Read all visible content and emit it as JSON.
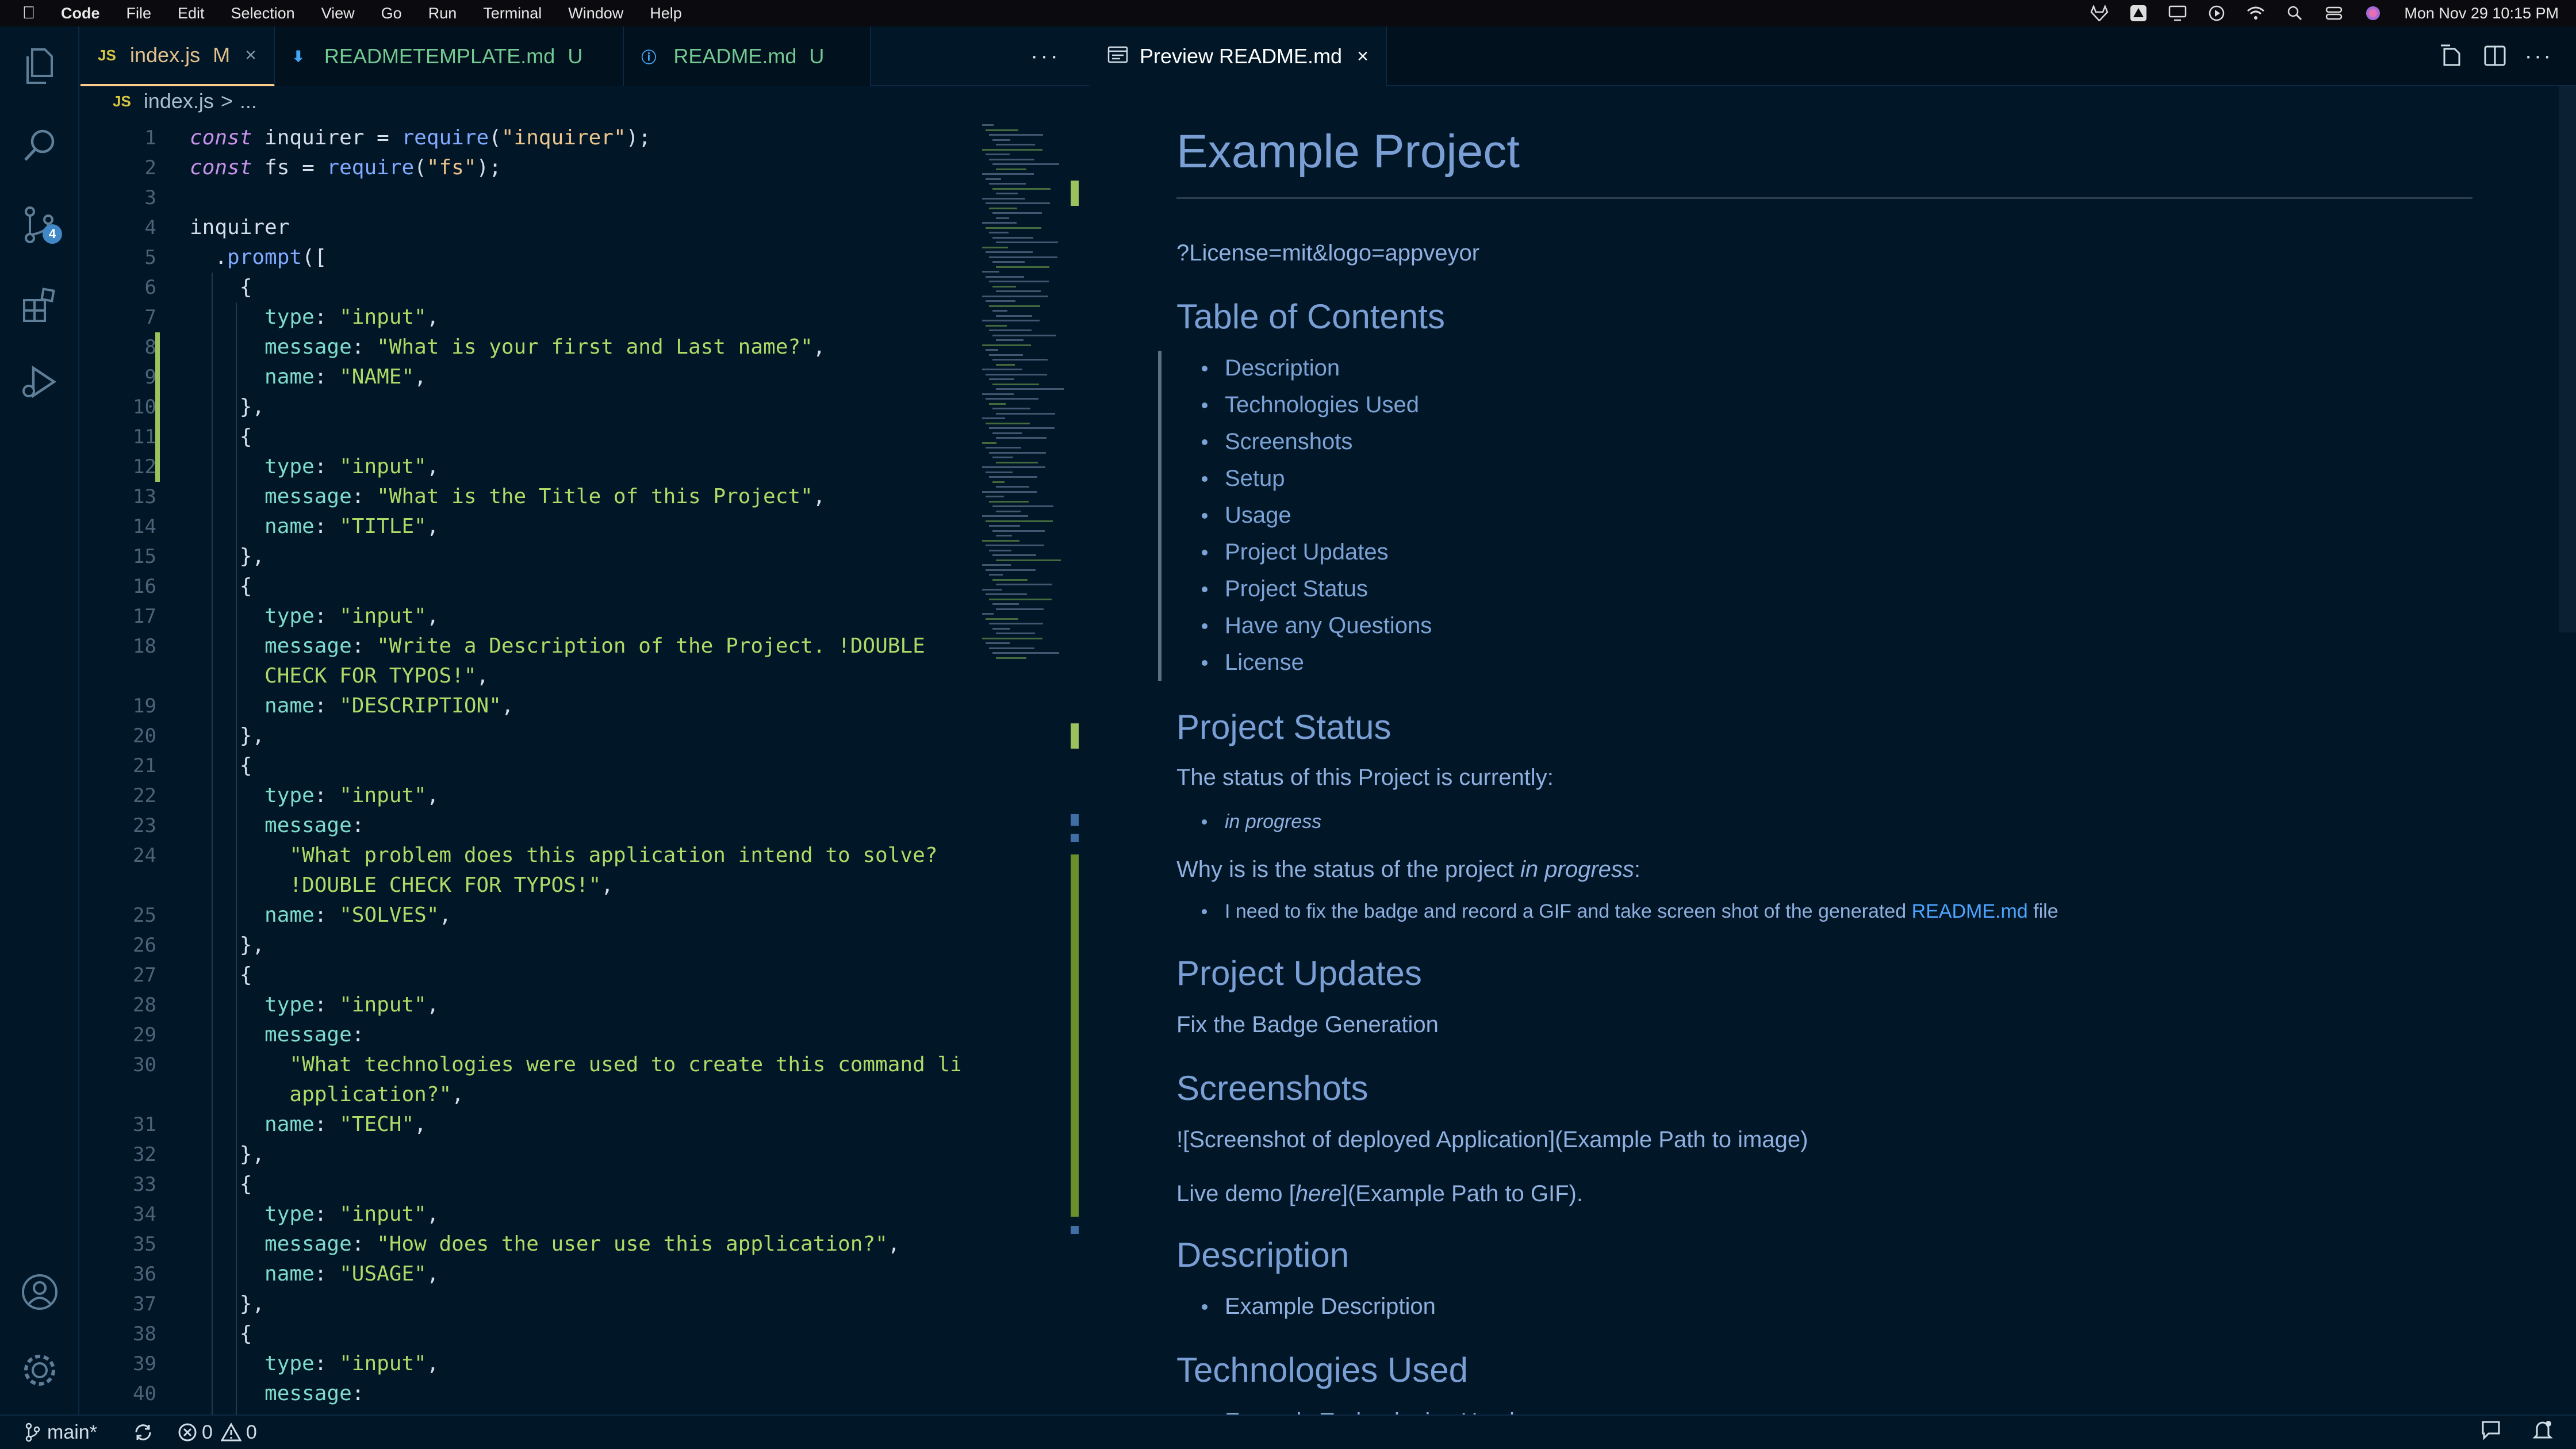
{
  "menubar": {
    "app": "Code",
    "items": [
      "File",
      "Edit",
      "Selection",
      "View",
      "Go",
      "Run",
      "Terminal",
      "Window",
      "Help"
    ],
    "clock": "Mon Nov 29  10:15 PM"
  },
  "activitybar": {
    "source_control_badge": "4"
  },
  "left_tabs": [
    {
      "icon": "JS",
      "label": "index.js",
      "state": "M",
      "close": "×"
    },
    {
      "icon": "⬇",
      "label": "READMETEMPLATE.md",
      "state": "U"
    },
    {
      "icon": "ⓘ",
      "label": "README.md",
      "state": "U"
    }
  ],
  "left_tabs_more": "···",
  "breadcrumb": {
    "icon": "JS",
    "file": "index.js",
    "sep": ">",
    "rest": "..."
  },
  "code_lines": [
    {
      "n": "1",
      "tokens": [
        [
          "kw",
          "const "
        ],
        [
          "var",
          "inquirer = "
        ],
        [
          "fn",
          "require"
        ],
        [
          "var",
          "("
        ],
        [
          "str",
          "\"inquirer\""
        ],
        [
          "var",
          ");"
        ]
      ]
    },
    {
      "n": "2",
      "tokens": [
        [
          "kw",
          "const "
        ],
        [
          "var",
          "fs = "
        ],
        [
          "fn",
          "require"
        ],
        [
          "var",
          "("
        ],
        [
          "str",
          "\"fs\""
        ],
        [
          "var",
          ");"
        ]
      ]
    },
    {
      "n": "3",
      "tokens": []
    },
    {
      "n": "4",
      "tokens": [
        [
          "var",
          "inquirer"
        ]
      ]
    },
    {
      "n": "5",
      "tokens": [
        [
          "var",
          "  ."
        ],
        [
          "fn",
          "prompt"
        ],
        [
          "var",
          "(["
        ]
      ]
    },
    {
      "n": "6",
      "tokens": [
        [
          "var",
          "    {"
        ]
      ]
    },
    {
      "n": "7",
      "tokens": [
        [
          "prop",
          "      type"
        ],
        [
          "var",
          ": "
        ],
        [
          "str2",
          "\"input\""
        ],
        [
          "var",
          ","
        ]
      ]
    },
    {
      "n": "8",
      "tokens": [
        [
          "prop",
          "      message"
        ],
        [
          "var",
          ": "
        ],
        [
          "str2",
          "\"What is your first and Last name?\""
        ],
        [
          "var",
          ","
        ]
      ]
    },
    {
      "n": "9",
      "tokens": [
        [
          "prop",
          "      name"
        ],
        [
          "var",
          ": "
        ],
        [
          "str2",
          "\"NAME\""
        ],
        [
          "var",
          ","
        ]
      ]
    },
    {
      "n": "10",
      "tokens": [
        [
          "var",
          "    },"
        ]
      ]
    },
    {
      "n": "11",
      "tokens": [
        [
          "var",
          "    {"
        ]
      ]
    },
    {
      "n": "12",
      "tokens": [
        [
          "prop",
          "      type"
        ],
        [
          "var",
          ": "
        ],
        [
          "str2",
          "\"input\""
        ],
        [
          "var",
          ","
        ]
      ]
    },
    {
      "n": "13",
      "tokens": [
        [
          "prop",
          "      message"
        ],
        [
          "var",
          ": "
        ],
        [
          "str2",
          "\"What is the Title of this Project\""
        ],
        [
          "var",
          ","
        ]
      ]
    },
    {
      "n": "14",
      "tokens": [
        [
          "prop",
          "      name"
        ],
        [
          "var",
          ": "
        ],
        [
          "str2",
          "\"TITLE\""
        ],
        [
          "var",
          ","
        ]
      ]
    },
    {
      "n": "15",
      "tokens": [
        [
          "var",
          "    },"
        ]
      ]
    },
    {
      "n": "16",
      "tokens": [
        [
          "var",
          "    {"
        ]
      ]
    },
    {
      "n": "17",
      "tokens": [
        [
          "prop",
          "      type"
        ],
        [
          "var",
          ": "
        ],
        [
          "str2",
          "\"input\""
        ],
        [
          "var",
          ","
        ]
      ]
    },
    {
      "n": "18",
      "tokens": [
        [
          "prop",
          "      message"
        ],
        [
          "var",
          ": "
        ],
        [
          "str2",
          "\"Write a Description of the Project. !DOUBLE"
        ]
      ]
    },
    {
      "n": "",
      "tokens": [
        [
          "str2",
          "      CHECK FOR TYPOS!\""
        ],
        [
          "var",
          ","
        ]
      ]
    },
    {
      "n": "19",
      "tokens": [
        [
          "prop",
          "      name"
        ],
        [
          "var",
          ": "
        ],
        [
          "str2",
          "\"DESCRIPTION\""
        ],
        [
          "var",
          ","
        ]
      ]
    },
    {
      "n": "20",
      "tokens": [
        [
          "var",
          "    },"
        ]
      ]
    },
    {
      "n": "21",
      "tokens": [
        [
          "var",
          "    {"
        ]
      ]
    },
    {
      "n": "22",
      "tokens": [
        [
          "prop",
          "      type"
        ],
        [
          "var",
          ": "
        ],
        [
          "str2",
          "\"input\""
        ],
        [
          "var",
          ","
        ]
      ]
    },
    {
      "n": "23",
      "tokens": [
        [
          "prop",
          "      message"
        ],
        [
          "var",
          ":"
        ]
      ]
    },
    {
      "n": "24",
      "tokens": [
        [
          "str2",
          "        \"What problem does this application intend to solve?"
        ]
      ]
    },
    {
      "n": "",
      "tokens": [
        [
          "str2",
          "        !DOUBLE CHECK FOR TYPOS!\""
        ],
        [
          "var",
          ","
        ]
      ]
    },
    {
      "n": "25",
      "tokens": [
        [
          "prop",
          "      name"
        ],
        [
          "var",
          ": "
        ],
        [
          "str2",
          "\"SOLVES\""
        ],
        [
          "var",
          ","
        ]
      ]
    },
    {
      "n": "26",
      "tokens": [
        [
          "var",
          "    },"
        ]
      ]
    },
    {
      "n": "27",
      "tokens": [
        [
          "var",
          "    {"
        ]
      ]
    },
    {
      "n": "28",
      "tokens": [
        [
          "prop",
          "      type"
        ],
        [
          "var",
          ": "
        ],
        [
          "str2",
          "\"input\""
        ],
        [
          "var",
          ","
        ]
      ]
    },
    {
      "n": "29",
      "tokens": [
        [
          "prop",
          "      message"
        ],
        [
          "var",
          ":"
        ]
      ]
    },
    {
      "n": "30",
      "tokens": [
        [
          "str2",
          "        \"What technologies were used to create this command line"
        ]
      ]
    },
    {
      "n": "",
      "tokens": [
        [
          "str2",
          "        application?\""
        ],
        [
          "var",
          ","
        ]
      ]
    },
    {
      "n": "31",
      "tokens": [
        [
          "prop",
          "      name"
        ],
        [
          "var",
          ": "
        ],
        [
          "str2",
          "\"TECH\""
        ],
        [
          "var",
          ","
        ]
      ]
    },
    {
      "n": "32",
      "tokens": [
        [
          "var",
          "    },"
        ]
      ]
    },
    {
      "n": "33",
      "tokens": [
        [
          "var",
          "    {"
        ]
      ]
    },
    {
      "n": "34",
      "tokens": [
        [
          "prop",
          "      type"
        ],
        [
          "var",
          ": "
        ],
        [
          "str2",
          "\"input\""
        ],
        [
          "var",
          ","
        ]
      ]
    },
    {
      "n": "35",
      "tokens": [
        [
          "prop",
          "      message"
        ],
        [
          "var",
          ": "
        ],
        [
          "str2",
          "\"How does the user use this application?\""
        ],
        [
          "var",
          ","
        ]
      ]
    },
    {
      "n": "36",
      "tokens": [
        [
          "prop",
          "      name"
        ],
        [
          "var",
          ": "
        ],
        [
          "str2",
          "\"USAGE\""
        ],
        [
          "var",
          ","
        ]
      ]
    },
    {
      "n": "37",
      "tokens": [
        [
          "var",
          "    },"
        ]
      ]
    },
    {
      "n": "38",
      "tokens": [
        [
          "var",
          "    {"
        ]
      ]
    },
    {
      "n": "39",
      "tokens": [
        [
          "prop",
          "      type"
        ],
        [
          "var",
          ": "
        ],
        [
          "str2",
          "\"input\""
        ],
        [
          "var",
          ","
        ]
      ]
    },
    {
      "n": "40",
      "tokens": [
        [
          "prop",
          "      message"
        ],
        [
          "var",
          ":"
        ]
      ]
    }
  ],
  "preview_tab": {
    "label": "Preview README.md",
    "close": "×"
  },
  "preview": {
    "title": "Example Project",
    "license_line": "?License=mit&logo=appveyor",
    "toc_heading": "Table of Contents",
    "toc": [
      "Description",
      "Technologies Used",
      "Screenshots",
      "Setup",
      "Usage",
      "Project Updates",
      "Project Status",
      "Have any Questions",
      "License"
    ],
    "status_heading": "Project Status",
    "status_text": "The status of this Project is currently:",
    "status_item": "in progress",
    "why_prefix": "Why is is the status of the project ",
    "why_em": "in progress",
    "why_suffix": ":",
    "why_item_text": "I need to fix the badge and record a GIF and take screen shot of the generated ",
    "why_item_link": "README.md",
    "why_item_suffix": " file",
    "updates_heading": "Project Updates",
    "updates_text": "Fix the Badge Generation",
    "screenshots_heading": "Screenshots",
    "screenshot_text": "![Screenshot of deployed Application](Example Path to image)",
    "livedemo_prefix": "Live demo [",
    "livedemo_em": "here",
    "livedemo_suffix": "](Example Path to GIF).",
    "description_heading": "Description",
    "description_item": "Example Description",
    "tech_heading": "Technologies Used",
    "tech_item": "Example Technologies Used"
  },
  "statusbar": {
    "branch": "main*",
    "errors": "0",
    "warnings": "0"
  },
  "colors": {
    "background": "#011627",
    "accent": "#ffcb8b",
    "git_modified": "#9bc25c"
  }
}
